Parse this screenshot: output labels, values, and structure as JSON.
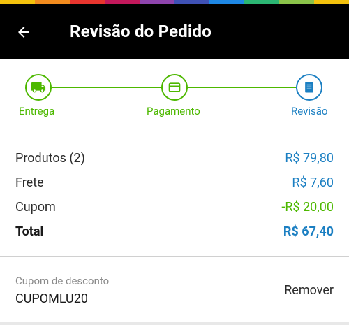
{
  "top_strip_colors": [
    "#f4c20d",
    "#f28c1e",
    "#e8352e",
    "#c2185b",
    "#8e44ad",
    "#3f51b5",
    "#1e88e5",
    "#2bb673",
    "#8bc34a",
    "#f4c20d"
  ],
  "header": {
    "title": "Revisão do Pedido",
    "back_icon": "arrow-left-icon"
  },
  "stepper": {
    "accent_done": "#4db800",
    "accent_current": "#1b7fc2",
    "steps": [
      {
        "label": "Entrega",
        "icon": "truck-icon",
        "state": "done"
      },
      {
        "label": "Pagamento",
        "icon": "credit-card-icon",
        "state": "done"
      },
      {
        "label": "Revisão",
        "icon": "document-list-icon",
        "state": "current"
      }
    ]
  },
  "summary": {
    "rows": [
      {
        "label": "Produtos (2)",
        "value": "R$ 79,80"
      },
      {
        "label": "Frete",
        "value": "R$ 7,60"
      },
      {
        "label": "Cupom",
        "value": "-R$ 20,00"
      }
    ],
    "total": {
      "label": "Total",
      "value": "R$ 67,40"
    }
  },
  "coupon": {
    "label": "Cupom de desconto",
    "code": "CUPOMLU20",
    "remove_label": "Remover"
  }
}
